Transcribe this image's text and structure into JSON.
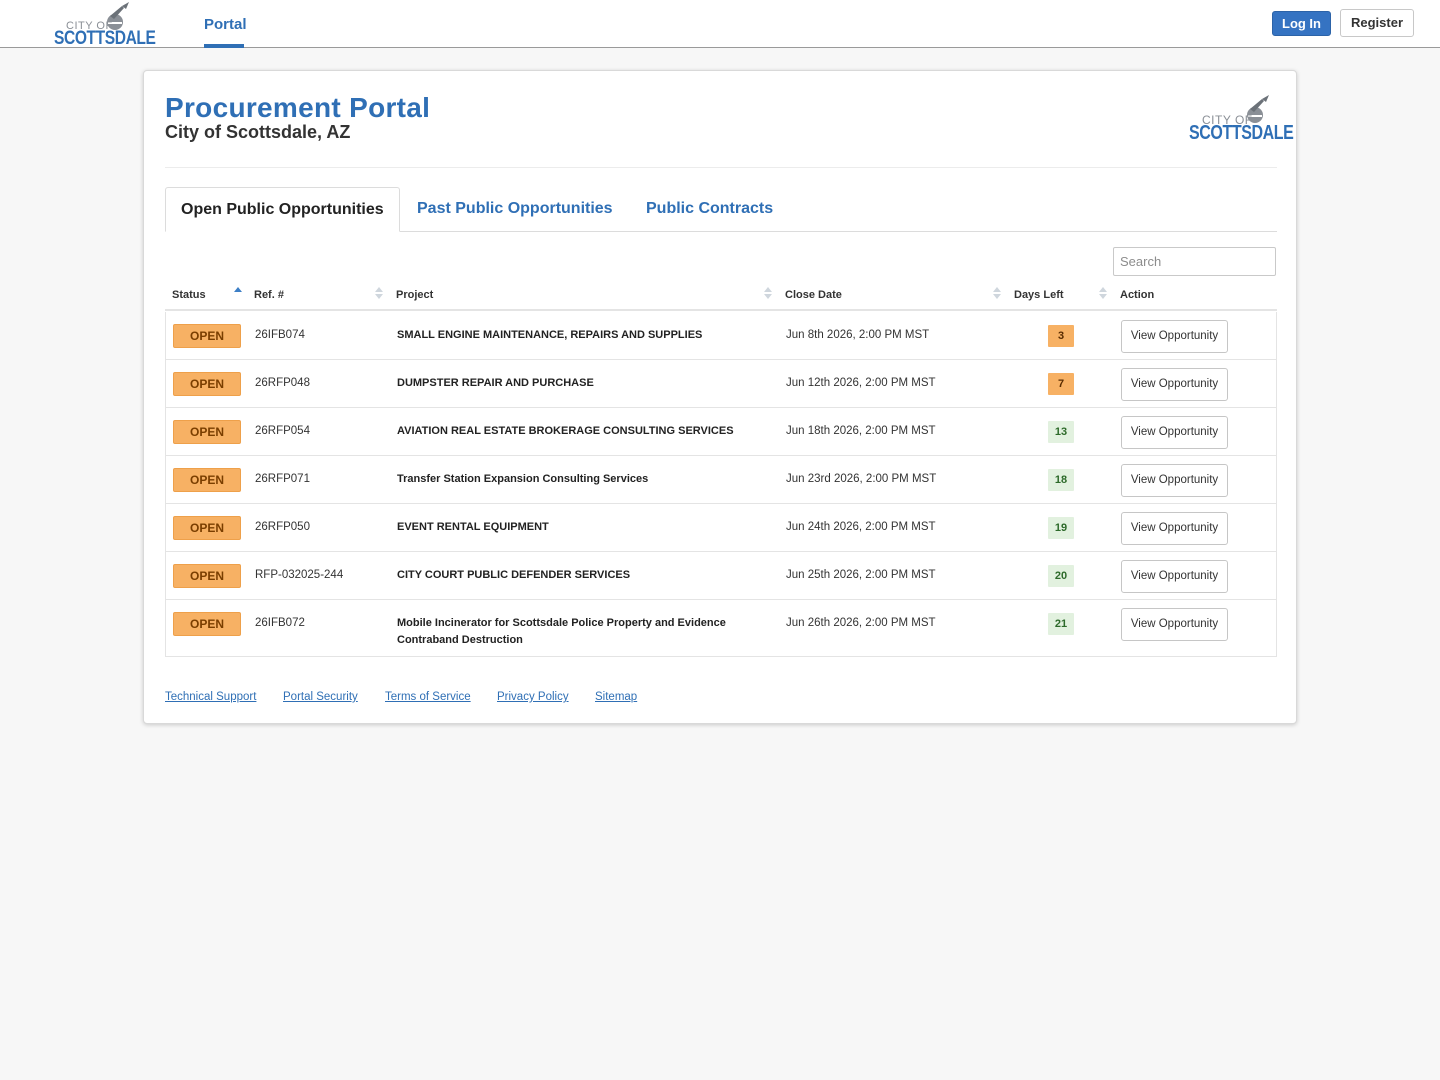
{
  "nav": {
    "logo_city": "CITY OF",
    "logo_name": "SCOTTSDALE",
    "portal_link": "Portal",
    "login_label": "Log In",
    "register_label": "Register"
  },
  "header": {
    "title": "Procurement Portal",
    "subtitle": "City of Scottsdale, AZ",
    "logo_city": "CITY OF",
    "logo_name": "SCOTTSDALE"
  },
  "tabs": [
    {
      "label": "Open Public Opportunities",
      "active": true
    },
    {
      "label": "Past Public Opportunities",
      "active": false
    },
    {
      "label": "Public Contracts",
      "active": false
    }
  ],
  "search": {
    "placeholder": "Search",
    "value": ""
  },
  "table": {
    "columns": [
      "Status",
      "Ref. #",
      "Project",
      "Close Date",
      "Days Left",
      "Action"
    ],
    "sorted_column": "Status",
    "sort_direction": "ascending",
    "rows": [
      {
        "status": "OPEN",
        "ref": "26IFB074",
        "project": "SMALL ENGINE MAINTENANCE, REPAIRS AND SUPPLIES",
        "close_date": "Jun 8th 2026, 2:00 PM MST",
        "days_left": "3",
        "days_color": "#f7b164",
        "action": "View Opportunity"
      },
      {
        "status": "OPEN",
        "ref": "26RFP048",
        "project": "DUMPSTER REPAIR AND PURCHASE",
        "close_date": "Jun 12th 2026, 2:00 PM MST",
        "days_left": "7",
        "days_color": "#f7b164",
        "action": "View Opportunity"
      },
      {
        "status": "OPEN",
        "ref": "26RFP054",
        "project": "AVIATION REAL ESTATE BROKERAGE CONSULTING SERVICES",
        "close_date": "Jun 18th 2026, 2:00 PM MST",
        "days_left": "13",
        "days_color": "#e2f1df",
        "action": "View Opportunity"
      },
      {
        "status": "OPEN",
        "ref": "26RFP071",
        "project": "Transfer Station Expansion Consulting Services",
        "close_date": "Jun 23rd 2026, 2:00 PM MST",
        "days_left": "18",
        "days_color": "#e2f1df",
        "action": "View Opportunity"
      },
      {
        "status": "OPEN",
        "ref": "26RFP050",
        "project": "EVENT RENTAL EQUIPMENT",
        "close_date": "Jun 24th 2026, 2:00 PM MST",
        "days_left": "19",
        "days_color": "#e2f1df",
        "action": "View Opportunity"
      },
      {
        "status": "OPEN",
        "ref": "RFP-032025-244",
        "project": "CITY COURT PUBLIC DEFENDER SERVICES",
        "close_date": "Jun 25th 2026, 2:00 PM MST",
        "days_left": "20",
        "days_color": "#e2f1df",
        "action": "View Opportunity"
      },
      {
        "status": "OPEN",
        "ref": "26IFB072",
        "project": "Mobile Incinerator for Scottsdale Police Property and Evidence Contraband Destruction",
        "close_date": "Jun 26th 2026, 2:00 PM MST",
        "days_left": "21",
        "days_color": "#e2f1df",
        "action": "View Opportunity"
      }
    ]
  },
  "footer": {
    "links": [
      "Technical Support",
      "Portal Security",
      "Terms of Service",
      "Privacy Policy",
      "Sitemap"
    ]
  },
  "colors": {
    "brand_blue": "#2f6fb5",
    "status_open": "#f7b164",
    "days_low": "#f7b164",
    "days_ok": "#e2f1df"
  }
}
